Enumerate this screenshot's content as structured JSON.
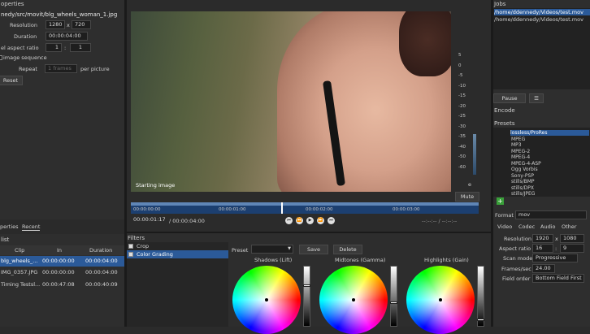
{
  "properties": {
    "title": "operties",
    "filepath": "nedy/src/movit/blg_wheels_woman_1.jpg",
    "resolution_label": "Resolution",
    "resolution_w": "1280",
    "resolution_x": "x",
    "resolution_h": "720",
    "duration_label": "Duration",
    "duration_value": "00:00:04:00",
    "aspect_label": "el aspect ratio",
    "aspect_a": "1",
    "aspect_sep": ":",
    "aspect_b": "1",
    "image_sequence_label": "image sequence",
    "repeat_label": "Repeat",
    "repeat_value": "1 frames",
    "per_picture": "per picture",
    "reset_label": "Reset"
  },
  "left_tabs": {
    "properties": "perties",
    "recent": "Recent"
  },
  "playlist": {
    "title": "list",
    "headers": [
      "Clip",
      "In",
      "Duration"
    ],
    "rows": [
      {
        "clip": "blg_wheels_...",
        "in": "00:00:00:00",
        "duration": "00:00:04:00"
      },
      {
        "clip": "IMG_0357.JPG",
        "in": "00:00:00:00",
        "duration": "00:00:04:00"
      },
      {
        "clip": "Timing Testsl...",
        "in": "00:00:47:08",
        "duration": "00:00:40:09"
      }
    ]
  },
  "viewer": {
    "overlay_text": "Starting image",
    "meter_ticks": [
      "5",
      "0",
      "-5",
      "-10",
      "-15",
      "-20",
      "-25",
      "-30",
      "-35",
      "-40",
      "-50",
      "-60"
    ],
    "mute_label": "Mute",
    "ruler_labels": [
      "00:00:00:00",
      "00:00:01:00",
      "00:00:02:00",
      "00:00:03:00"
    ],
    "current_time": "00:00:01:17",
    "total_time": "/ 00:00:04:00",
    "in_out": "--:--:-- / --:--:--"
  },
  "filters": {
    "title": "Filters",
    "items": [
      {
        "label": "Crop",
        "checked": true
      },
      {
        "label": "Color Grading",
        "checked": true
      }
    ],
    "preset_label": "Preset",
    "save_label": "Save",
    "delete_label": "Delete",
    "wheels": [
      {
        "label": "Shadows (Lift)",
        "level": 0.32
      },
      {
        "label": "Midtones (Gamma)",
        "level": 0.62
      },
      {
        "label": "Highlights (Gain)",
        "level": 0.92
      }
    ]
  },
  "jobs": {
    "title": "Jobs",
    "items": [
      "/home/ddennedy/Videos/test.mov",
      "/home/ddennedy/Videos/test.mov"
    ],
    "pause_label": "Pause",
    "menu_icon": "☰"
  },
  "encode": {
    "title": "Encode",
    "presets_label": "Presets",
    "presets": [
      "lossless/ProRes",
      "MPEG",
      "MP3",
      "MPEG-2",
      "MPEG-4",
      "MPEG-4-ASP",
      "Ogg Vorbis",
      "Sony-PSP",
      "stills/BMP",
      "stills/DPX",
      "stills/JPEG"
    ],
    "format_label": "Format",
    "format_value": "mov",
    "tabs": [
      "Video",
      "Codec",
      "Audio",
      "Other"
    ],
    "resolution_label": "Resolution",
    "res_w": "1920",
    "res_x": "x",
    "res_h": "1080",
    "aspect_label": "Aspect ratio",
    "aspect_a": "16",
    "aspect_sep": ":",
    "aspect_b": "9",
    "scan_label": "Scan mode",
    "scan_value": "Progressive",
    "fps_label": "Frames/sec",
    "fps_value": "24.00",
    "field_label": "Field order",
    "field_value": "Bottom Field First"
  }
}
